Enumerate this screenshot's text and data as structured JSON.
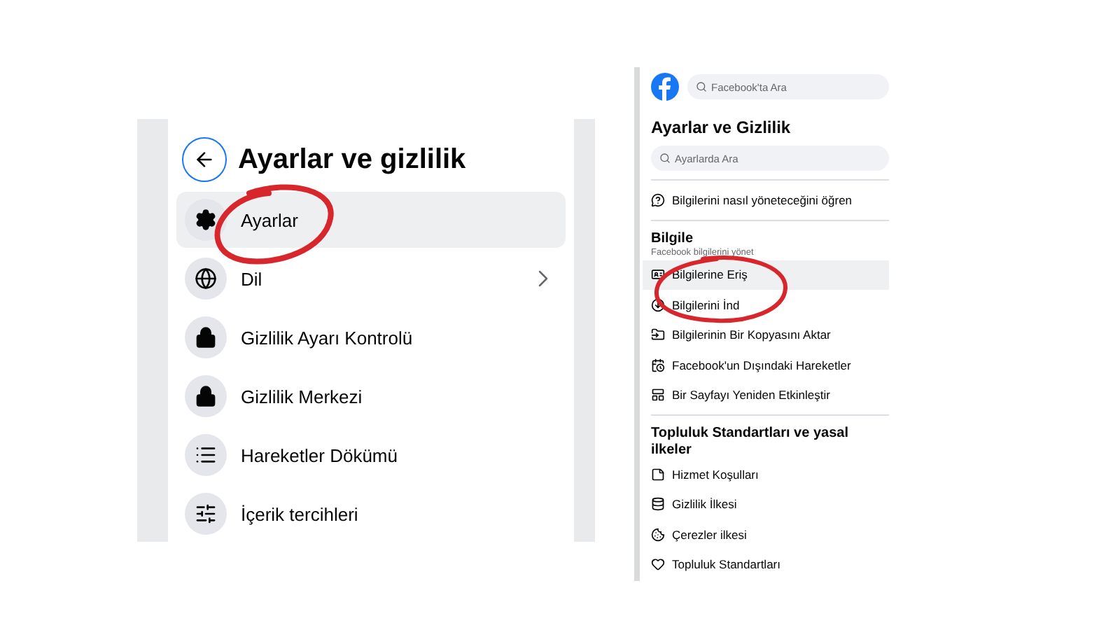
{
  "left_panel": {
    "title": "Ayarlar ve gizlilik",
    "items": [
      {
        "label": "Ayarlar",
        "selected": true,
        "submenu": false
      },
      {
        "label": "Dil",
        "selected": false,
        "submenu": true
      },
      {
        "label": "Gizlilik Ayarı Kontrolü",
        "selected": false,
        "submenu": false
      },
      {
        "label": "Gizlilik Merkezi",
        "selected": false,
        "submenu": false
      },
      {
        "label": "Hareketler Dökümü",
        "selected": false,
        "submenu": false
      },
      {
        "label": "İçerik tercihleri",
        "selected": false,
        "submenu": false
      }
    ]
  },
  "right_panel": {
    "search": {
      "placeholder": "Facebook'ta Ara"
    },
    "title": "Ayarlar ve Gizlilik",
    "settings_search": {
      "placeholder": "Ayarlarda Ara"
    },
    "sections": [
      {
        "items": [
          {
            "label": "Bilgilerini nasıl yöneteceğini öğren",
            "selected": false
          }
        ]
      },
      {
        "title": "Bilgile",
        "subtitle": "Facebook bilgilerini yönet",
        "items": [
          {
            "label": "Bilgilerine Eriş",
            "selected": true
          },
          {
            "label": "Bilgilerini İnd",
            "selected": false
          },
          {
            "label": "Bilgilerinin Bir Kopyasını Aktar",
            "selected": false
          },
          {
            "label": "Facebook'un Dışındaki Hareketler",
            "selected": false
          },
          {
            "label": "Bir Sayfayı Yeniden Etkinleştir",
            "selected": false
          }
        ]
      },
      {
        "title": "Topluluk Standartları ve yasal ilkeler",
        "items": [
          {
            "label": "Hizmet Koşulları",
            "selected": false
          },
          {
            "label": "Gizlilik İlkesi",
            "selected": false
          },
          {
            "label": "Çerezler ilkesi",
            "selected": false
          },
          {
            "label": "Topluluk Standartları",
            "selected": false
          }
        ]
      }
    ]
  }
}
